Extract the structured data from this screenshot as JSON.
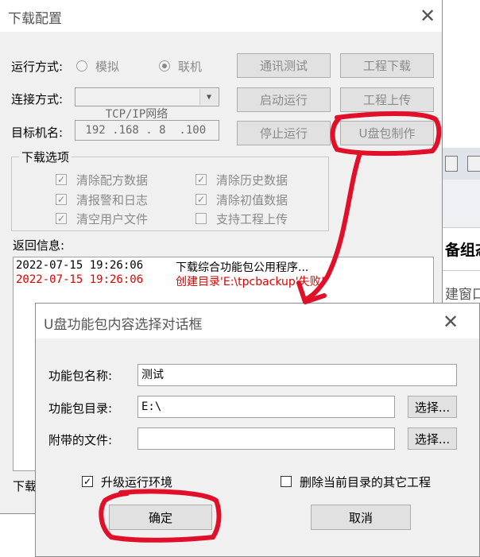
{
  "background_window": {
    "text1": "备组态",
    "text2": "建窗口"
  },
  "main_dialog": {
    "title": "下载配置",
    "close_glyph": "✕",
    "run_mode": {
      "label": "运行方式:",
      "option_sim": "模拟",
      "option_online": "联机"
    },
    "connect_mode": {
      "label": "连接方式:",
      "value": "TCP/IP网络",
      "arrow": "▼"
    },
    "target": {
      "label": "目标机名:",
      "value": " 192 .168 . 8  .100"
    },
    "buttons": {
      "comm_test": "通讯测试",
      "project_download": "工程下载",
      "start_run": "启动运行",
      "project_upload": "工程上传",
      "stop_run": "停止运行",
      "usb_package": "U盘包制作"
    },
    "download_options": {
      "title": "下载选项",
      "items": [
        {
          "label": "清除配方数据",
          "checked": true
        },
        {
          "label": "清除历史数据",
          "checked": true
        },
        {
          "label": "清报警和日志",
          "checked": true
        },
        {
          "label": "清除初值数据",
          "checked": true
        },
        {
          "label": "清空用户文件",
          "checked": true
        },
        {
          "label": "支持工程上传",
          "checked": false
        }
      ]
    },
    "return_info": {
      "label": "返回信息:",
      "lines": [
        {
          "time": "2022-07-15 19:26:06",
          "message": "下载综合功能包公用程序..."
        },
        {
          "time": "2022-07-15 19:26:06",
          "message": "创建目录'E:\\tpcbackup'失败!"
        }
      ]
    },
    "bottom_label": "下载"
  },
  "sub_dialog": {
    "title": "U盘功能包内容选择对话框",
    "close_glyph": "✕",
    "package_name": {
      "label": "功能包名称:",
      "value": "测试"
    },
    "package_dir": {
      "label": "功能包目录:",
      "value": "E:\\",
      "button": "选择..."
    },
    "attached_files": {
      "label": "附带的文件:",
      "value": "",
      "button": "选择..."
    },
    "upgrade_env": {
      "label": "升级运行环境",
      "checked": true
    },
    "delete_others": {
      "label": "删除当前目录的其它工程",
      "checked": false
    },
    "ok_button": "确定",
    "cancel_button": "取消",
    "check_glyph": "✓"
  },
  "colors": {
    "annotation_red": "#e0102a",
    "log_red": "#e00000"
  }
}
